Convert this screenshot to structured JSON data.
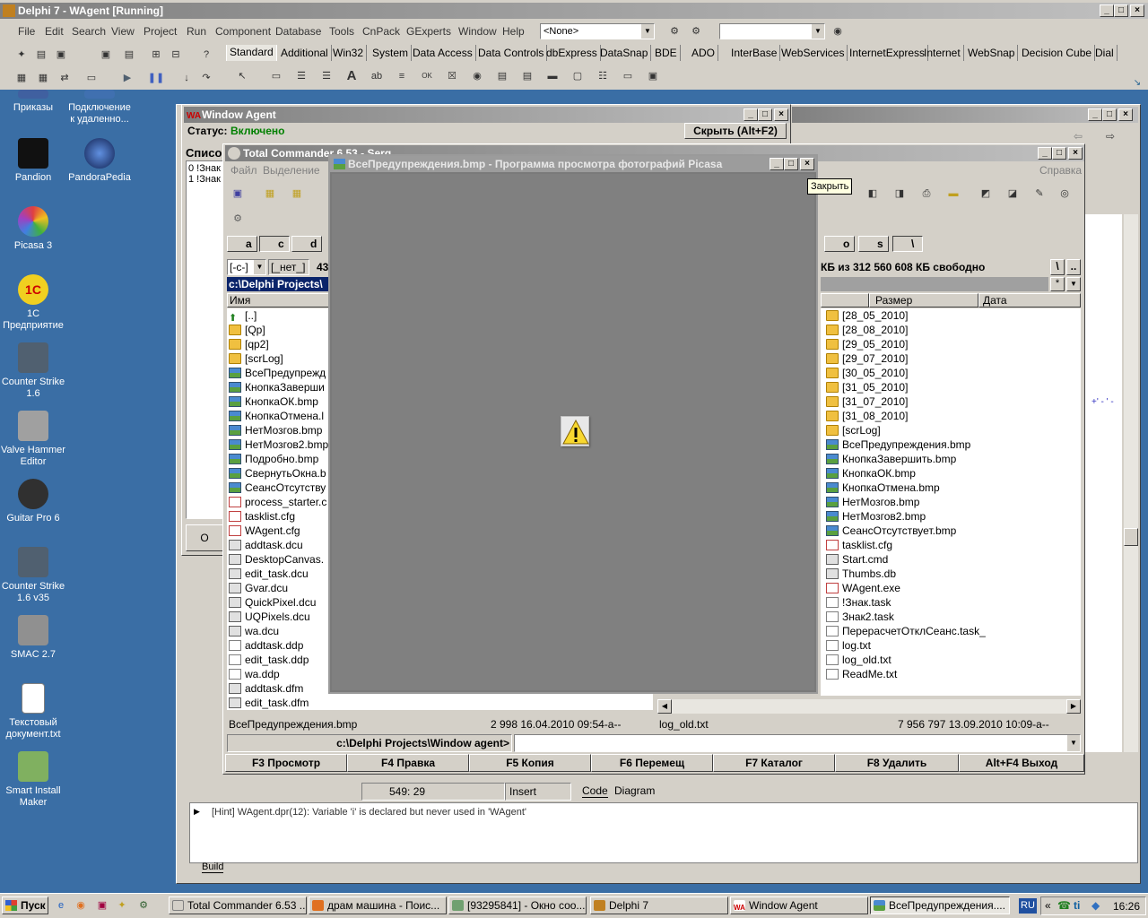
{
  "delphi": {
    "title": "Delphi 7 - WAgent [Running]",
    "menu": [
      "File",
      "Edit",
      "Search",
      "View",
      "Project",
      "Run",
      "Component",
      "Database",
      "Tools",
      "CnPack",
      "GExperts",
      "Window",
      "Help"
    ],
    "combo1": "<None>",
    "palette_tabs": [
      "Standard",
      "Additional",
      "Win32",
      "System",
      "Data Access",
      "Data Controls",
      "dbExpress",
      "DataSnap",
      "BDE",
      "ADO",
      "InterBase",
      "WebServices",
      "InternetExpress",
      "Internet",
      "WebSnap",
      "Decision Cube",
      "Dial"
    ]
  },
  "desktop": {
    "icons": [
      {
        "label": "Приказы",
        "color": "#4060a0"
      },
      {
        "label": "Подключение к удаленно...",
        "color": "#4070b0"
      },
      {
        "label": "Pandion",
        "color": "#202020"
      },
      {
        "label": "PandoraPedia",
        "color": "#1a3a80"
      },
      {
        "label": "Picasa 3",
        "color": "#e0e0e0"
      },
      {
        "label": "1С Предприятие",
        "color": "#f0d020"
      },
      {
        "label": "Counter Strike 1.6",
        "color": "#506070"
      },
      {
        "label": "Valve Hammer Editor",
        "color": "#a0a0a0"
      },
      {
        "label": "Guitar Pro 6",
        "color": "#303030"
      },
      {
        "label": "Counter Strike 1.6 v35",
        "color": "#506070"
      },
      {
        "label": "SMAC 2.7",
        "color": "#909090"
      },
      {
        "label": "Текстовый документ.txt",
        "color": "#ffffff"
      },
      {
        "label": "Smart Install Maker",
        "color": "#80b060"
      }
    ]
  },
  "wagent": {
    "title": "Window Agent",
    "status_label": "Статус:",
    "status_value": "Включено",
    "hide_button": "Скрыть (Alt+F2)",
    "list_label": "Списо",
    "items": [
      "0 !Знак",
      "1 !Знак"
    ],
    "ok": "О"
  },
  "tc": {
    "title": "Total Commander 6.53 - Serg",
    "menu_left": [
      "Файл",
      "Выделение"
    ],
    "menu_right": "Справка",
    "drives_left": [
      "a",
      "c",
      "d"
    ],
    "drives_right": [
      "o",
      "s",
      "\\"
    ],
    "drive_combo": "[-c-]",
    "drive_label": "[_нет_]",
    "free_left": "43",
    "free_right": "КБ из 312 560 608 КБ свободно",
    "path_left": "c:\\Delphi Projects\\",
    "col_name": "Имя",
    "col_size": "Размер",
    "col_date": "Дата",
    "left_files": [
      {
        "n": "[..]",
        "t": "up"
      },
      {
        "n": "[Qp]",
        "t": "folder"
      },
      {
        "n": "[qp2]",
        "t": "folder"
      },
      {
        "n": "[scrLog]",
        "t": "folder"
      },
      {
        "n": "ВсеПредупрежд",
        "t": "bmp"
      },
      {
        "n": "КнопкаЗаверши",
        "t": "bmp"
      },
      {
        "n": "КнопкаОК.bmp",
        "t": "bmp"
      },
      {
        "n": "КнопкаОтмена.l",
        "t": "bmp"
      },
      {
        "n": "НетМозгов.bmp",
        "t": "bmp"
      },
      {
        "n": "НетМозгов2.bmp",
        "t": "bmp"
      },
      {
        "n": "Подробно.bmp",
        "t": "bmp"
      },
      {
        "n": "СвернутьОкна.b",
        "t": "bmp"
      },
      {
        "n": "СеансОтсутству",
        "t": "bmp"
      },
      {
        "n": "process_starter.c",
        "t": "cfg"
      },
      {
        "n": "tasklist.cfg",
        "t": "cfg"
      },
      {
        "n": "WAgent.cfg",
        "t": "cfg"
      },
      {
        "n": "addtask.dcu",
        "t": "dcu"
      },
      {
        "n": "DesktopCanvas.",
        "t": "dcu"
      },
      {
        "n": "edit_task.dcu",
        "t": "dcu"
      },
      {
        "n": "Gvar.dcu",
        "t": "dcu"
      },
      {
        "n": "QuickPixel.dcu",
        "t": "dcu"
      },
      {
        "n": "UQPixels.dcu",
        "t": "dcu"
      },
      {
        "n": "wa.dcu",
        "t": "dcu"
      },
      {
        "n": "addtask.ddp",
        "t": "doc"
      },
      {
        "n": "edit_task.ddp",
        "t": "doc"
      },
      {
        "n": "wa.ddp",
        "t": "doc"
      },
      {
        "n": "addtask.dfm",
        "t": "dfm"
      },
      {
        "n": "edit_task.dfm",
        "t": "dfm"
      }
    ],
    "right_files": [
      {
        "n": "[28_05_2010]",
        "t": "folder"
      },
      {
        "n": "[28_08_2010]",
        "t": "folder"
      },
      {
        "n": "[29_05_2010]",
        "t": "folder"
      },
      {
        "n": "[29_07_2010]",
        "t": "folder"
      },
      {
        "n": "[30_05_2010]",
        "t": "folder"
      },
      {
        "n": "[31_05_2010]",
        "t": "folder"
      },
      {
        "n": "[31_07_2010]",
        "t": "folder"
      },
      {
        "n": "[31_08_2010]",
        "t": "folder"
      },
      {
        "n": "[scrLog]",
        "t": "folder"
      },
      {
        "n": "ВсеПредупреждения.bmp",
        "t": "bmp"
      },
      {
        "n": "КнопкаЗавершить.bmp",
        "t": "bmp"
      },
      {
        "n": "КнопкаОК.bmp",
        "t": "bmp"
      },
      {
        "n": "КнопкаОтмена.bmp",
        "t": "bmp"
      },
      {
        "n": "НетМозгов.bmp",
        "t": "bmp"
      },
      {
        "n": "НетМозгов2.bmp",
        "t": "bmp"
      },
      {
        "n": "СеансОтсутствует.bmp",
        "t": "bmp"
      },
      {
        "n": "tasklist.cfg",
        "t": "cfg"
      },
      {
        "n": "Start.cmd",
        "t": "dcu"
      },
      {
        "n": "Thumbs.db",
        "t": "dcu"
      },
      {
        "n": "WAgent.exe",
        "t": "exe"
      },
      {
        "n": "!Знак.task",
        "t": "doc"
      },
      {
        "n": "Знак2.task",
        "t": "doc"
      },
      {
        "n": "ПерерасчетОтклСеанс.task_",
        "t": "doc"
      },
      {
        "n": "log.txt",
        "t": "doc"
      },
      {
        "n": "log_old.txt",
        "t": "doc"
      },
      {
        "n": "ReadMe.txt",
        "t": "doc"
      }
    ],
    "status_left_name": "ВсеПредупреждения.bmp",
    "status_left_info": "2 998 16.04.2010 09:54-a--",
    "status_right_name": "log_old.txt",
    "status_right_info": "7 956 797 13.09.2010 10:09-a--",
    "cmd_path": "c:\\Delphi Projects\\Window agent>",
    "fkeys": [
      "F3 Просмотр",
      "F4 Правка",
      "F5 Копия",
      "F6 Перемещ",
      "F7 Каталог",
      "F8 Удалить",
      "Alt+F4 Выход"
    ]
  },
  "picasa": {
    "title": "ВсеПредупреждения.bmp - Программа просмотра фотографий Picasa",
    "tooltip": "Закрыть"
  },
  "editor": {
    "position": "549: 29",
    "mode": "Insert",
    "tab_code": "Code",
    "tab_diagram": "Diagram",
    "hint": "[Hint] WAgent.dpr(12): Variable 'i' is declared but never used in 'WAgent'",
    "tab_build": "Build"
  },
  "taskbar": {
    "start": "Пуск",
    "tasks": [
      "Total Commander 6.53 ...",
      "драм машина - Поис...",
      "[93295841] - Окно соо...",
      "Delphi 7",
      "Window Agent",
      "ВсеПредупреждения...."
    ],
    "lang": "RU",
    "clock": "16:26"
  }
}
